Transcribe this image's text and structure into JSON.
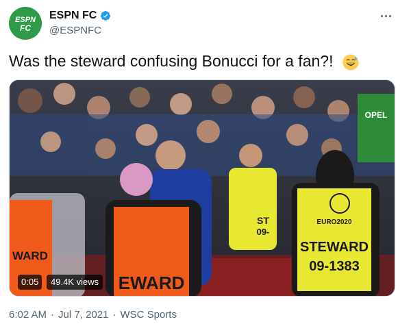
{
  "account": {
    "display_name": "ESPN FC",
    "handle": "@ESPNFC",
    "avatar_text_top": "ESPN",
    "avatar_text_bottom": "FC",
    "avatar_color": "#2e9a4a",
    "verified_color": "#1d9bf0"
  },
  "tweet": {
    "text": "Was the steward confusing Bonucci for a fan?!",
    "emoji": "sweat-smile-emoji"
  },
  "media": {
    "duration": "0:05",
    "views": "49.4K views",
    "bib_left_text": "WARD",
    "bib_center_text": "EWARD",
    "bib_middle_text_top": "ST",
    "bib_middle_text_bottom": "09-",
    "bib_right_logo": "EURO2020",
    "bib_right_text_top": "STEWARD",
    "bib_right_text_bottom": "09-1383",
    "sponsor_shirt_text": "OPEL",
    "vest_color": "#e8e832",
    "orange_vest_color": "#f05a1a"
  },
  "footer": {
    "time": "6:02 AM",
    "date": "Jul 7, 2021",
    "source": "WSC Sports",
    "separator": "·"
  }
}
